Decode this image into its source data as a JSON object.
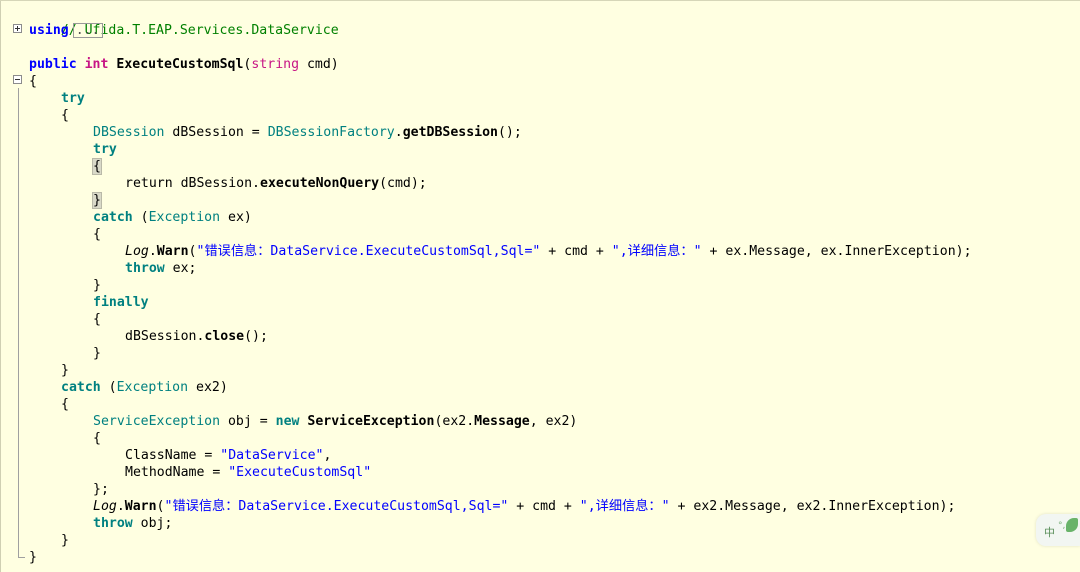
{
  "editor": {
    "comment": "// Ufida.T.EAP.Services.DataService",
    "using_keyword": "using",
    "using_collapsed": "...",
    "method_signature": {
      "modifier": "public",
      "return_type": "int",
      "name": "ExecuteCustomSql",
      "param_type": "string",
      "param_name": "cmd"
    },
    "tokens": {
      "open_brace": "{",
      "close_brace": "}",
      "try": "try",
      "catch": "catch",
      "finally": "finally",
      "throw": "throw",
      "return": "return",
      "new": "new",
      "dbsession_type": "DBSession",
      "dbsession_var": " dBSession = ",
      "factory": "DBSessionFactory",
      "get_method": "getDBSession",
      "get_tail": "();",
      "dbsession_call": "dBSession.",
      "exec_method": "executeNonQuery",
      "exec_tail": "(cmd);",
      "exception_type": "Exception",
      "ex_var": " ex)",
      "ex2_var": " ex2)",
      "log": "Log",
      "warn": "Warn",
      "warn_str_1": "\"错误信息：DataService.ExecuteCustomSql,Sql=\"",
      "warn_plus_cmd": " + cmd + ",
      "warn_str_2": "\",详细信息：\"",
      "warn_tail_1": " + ex.Message, ex.InnerException);",
      "warn_tail_2": " + ex2.Message, ex2.InnerException);",
      "throw_ex": " ex;",
      "throw_obj": " obj;",
      "close_call": "close",
      "close_tail": "();",
      "service_exception_type": "ServiceException",
      "obj_assign": " obj = ",
      "service_exception_ctor": "ServiceException",
      "ctor_args_a": "(ex2.",
      "message_prop": "Message",
      "ctor_args_b": ", ex2)",
      "class_name_prop": "ClassName = ",
      "class_name_val": "\"DataService\"",
      "comma": ",",
      "method_name_prop": "MethodName = ",
      "method_name_val": "\"ExecuteCustomSql\"",
      "close_init": "};",
      "paren_open": "(",
      "dot": ".",
      "space": " "
    }
  },
  "ime": {
    "label": "中",
    "dots": "°,"
  }
}
